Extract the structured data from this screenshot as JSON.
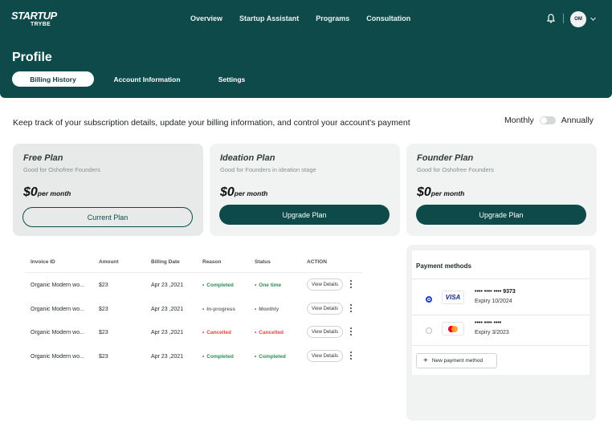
{
  "brand": {
    "line1": "STARTUP",
    "line2": "TRYBE"
  },
  "nav": [
    "Overview",
    "Startup Assistant",
    "Programs",
    "Consultation"
  ],
  "user": {
    "initials": "OM"
  },
  "page_title": "Profile",
  "tabs": [
    "Billing History",
    "Account Information",
    "Settings"
  ],
  "intro": "Keep track of your subscription details, update your billing information, and control your account's payment",
  "billing_toggle": {
    "left": "Monthly",
    "right": "Annually"
  },
  "plans": [
    {
      "name": "Free Plan",
      "subtitle": "Good for Oshofree Founders",
      "price": "$0",
      "period": "per month",
      "button": "Current Plan"
    },
    {
      "name": "Ideation Plan",
      "subtitle": "Good for Founders in ideation stage",
      "price": "$0",
      "period": "per month",
      "button": "Upgrade Plan"
    },
    {
      "name": "Founder Plan",
      "subtitle": "Good for Oshofree Founders",
      "price": "$0",
      "period": "per month",
      "button": "Upgrade Plan"
    }
  ],
  "invoices": {
    "columns": [
      "Invoice ID",
      "Amount",
      "Billing Date",
      "Reason",
      "Status",
      "ACTION"
    ],
    "rows": [
      {
        "id": "Organic Modern wo...",
        "amount": "$23",
        "date": "Apr 23 ,2021",
        "reason": "Completed",
        "status": "One time",
        "action": "View Details"
      },
      {
        "id": "Organic Modern wo...",
        "amount": "$23",
        "date": "Apr 23 ,2021",
        "reason": "In-progress",
        "status": "Monthly",
        "action": "View Details"
      },
      {
        "id": "Organic Modern wo...",
        "amount": "$23",
        "date": "Apr 23 ,2021",
        "reason": "Cancelled",
        "status": "Cancelled",
        "action": "View Details"
      },
      {
        "id": "Organic Modern wo...",
        "amount": "$23",
        "date": "Apr 23 ,2021",
        "reason": "Completed",
        "status": "Completed",
        "action": "View Details"
      }
    ]
  },
  "payment": {
    "title": "Payment methods",
    "methods": [
      {
        "brand": "VISA",
        "number": "•••• •••• •••• 9373",
        "expiry": "Expiry 10/2024",
        "selected": true
      },
      {
        "brand": "mastercard-icon",
        "number": "•••• •••• ••••",
        "expiry": "Expiry 3/2023",
        "selected": false
      }
    ],
    "add_label": "New payment method"
  },
  "colors": {
    "brand": "#0f4a4a",
    "green": "#2e8b57",
    "red": "#e0453a",
    "grey": "#6b7272",
    "visa": "#1a2a8c"
  }
}
